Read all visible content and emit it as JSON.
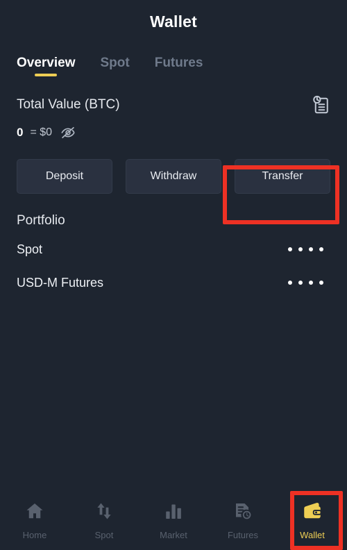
{
  "header": {
    "title": "Wallet"
  },
  "tabs": [
    {
      "label": "Overview",
      "active": true
    },
    {
      "label": "Spot",
      "active": false
    },
    {
      "label": "Futures",
      "active": false
    }
  ],
  "total": {
    "label": "Total Value (BTC)",
    "amount": "0",
    "fiat": "= $0",
    "eye_icon": "eye-off-icon",
    "history_icon": "transaction-history-icon"
  },
  "actions": [
    {
      "label": "Deposit",
      "highlighted": false
    },
    {
      "label": "Withdraw",
      "highlighted": false
    },
    {
      "label": "Transfer",
      "highlighted": true
    }
  ],
  "portfolio": {
    "title": "Portfolio",
    "rows": [
      {
        "name": "Spot",
        "value_masked": "••••"
      },
      {
        "name": "USD-M Futures",
        "value_masked": "••••"
      }
    ]
  },
  "bottom_nav": [
    {
      "label": "Home",
      "icon": "home-icon",
      "active": false
    },
    {
      "label": "Spot",
      "icon": "swap-arrows-icon",
      "active": false
    },
    {
      "label": "Market",
      "icon": "bar-chart-icon",
      "active": false
    },
    {
      "label": "Futures",
      "icon": "document-clock-icon",
      "active": false
    },
    {
      "label": "Wallet",
      "icon": "wallet-icon",
      "active": true
    }
  ],
  "colors": {
    "background": "#1e2530",
    "button_fill": "#2a3140",
    "accent_yellow": "#eece54",
    "highlight_red": "#ee3124",
    "inactive_gray": "#6f7a8b"
  }
}
